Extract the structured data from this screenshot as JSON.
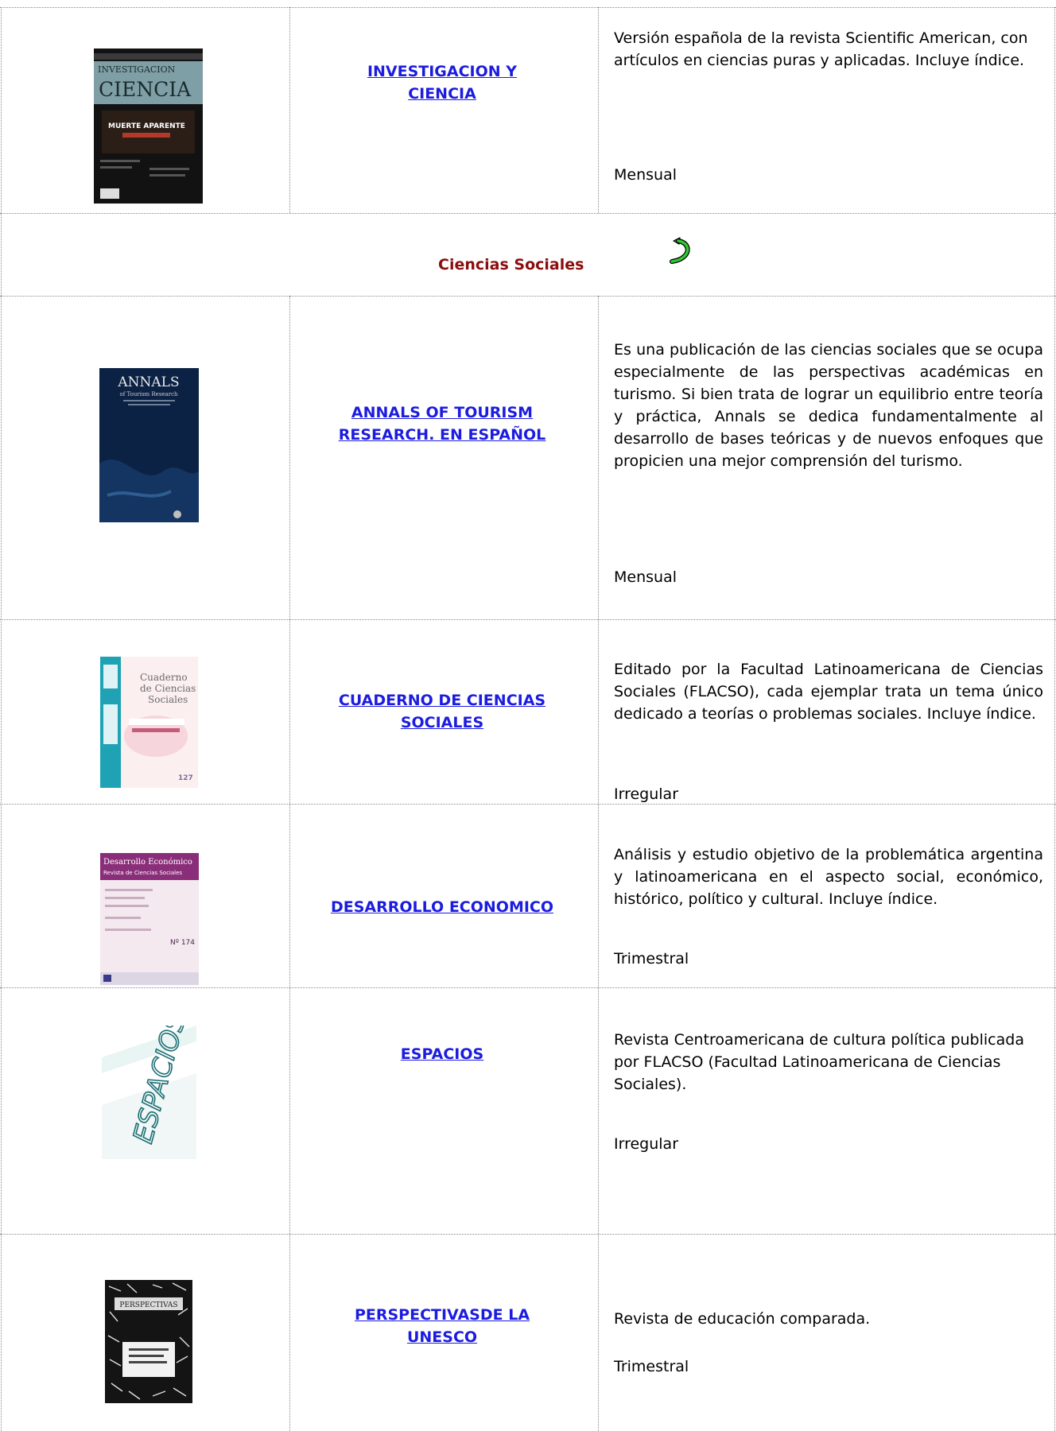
{
  "rows": [
    {
      "title": "INVESTIGACION Y CIENCIA",
      "title_line1": "INVESTIGACION Y",
      "title_line2": "CIENCIA",
      "description": "Versión española de la revista Scientific American, con artículos en ciencias puras y aplicadas. Incluye índice.",
      "frequency": "Mensual",
      "cover_text": [
        "INVESTIGACION",
        "CIENCIA",
        "MUERTE APARENTE"
      ]
    },
    {
      "title_line1": "ANNALS OF TOURISM",
      "title_line2": "RESEARCH. EN ESPAÑOL",
      "description": "Es una publicación de las ciencias sociales que se ocupa especialmente de las perspectivas académicas en turismo. Si bien trata de lograr un equilibrio entre teoría y práctica, Annals se dedica fundamentalmente al desarrollo de bases teóricas y de nuevos enfoques que propicien una mejor comprensión del turismo.",
      "frequency": "Mensual",
      "cover_text": [
        "ANNALS",
        "of Tourism Research"
      ]
    },
    {
      "title_line1": "CUADERNO DE CIENCIAS",
      "title_line2": "SOCIALES",
      "description": "Editado por la Facultad Latinoamericana de Ciencias Sociales (FLACSO), cada ejemplar trata un tema único dedicado a teorías o problemas sociales.  Incluye índice.",
      "frequency": "Irregular",
      "cover_text": [
        "Cuaderno",
        "de Ciencias",
        "Sociales",
        "127"
      ]
    },
    {
      "title_line1": "DESARROLLO ECONOMICO",
      "description": "Análisis y estudio objetivo de la problemática argentina y latinoamericana en el aspecto social, económico, histórico, político y cultural. Incluye índice.",
      "frequency": "Trimestral",
      "cover_text": [
        "Desarrollo Económico",
        "Revista de Ciencias Sociales",
        "Nº 174"
      ]
    },
    {
      "title_line1": "ESPACIOS",
      "description": "Revista Centroamericana de cultura política publicada por FLACSO (Facultad Latinoamericana de Ciencias Sociales).",
      "frequency": "Irregular",
      "cover_text": [
        "ESPACIOS"
      ]
    },
    {
      "title_line1": "PERSPECTIVASDE LA",
      "title_line2": "UNESCO",
      "description": "Revista de educación comparada.",
      "frequency": "Trimestral",
      "cover_text": [
        "PERSPECTIVAS"
      ]
    }
  ],
  "section": {
    "title": "Ciencias Sociales",
    "back_icon": "curved-back-arrow-icon"
  },
  "colors": {
    "link": "#1c1ce0",
    "section_title": "#8b0d0d",
    "arrow": "#32c832",
    "grid": "#8a8a8a"
  }
}
